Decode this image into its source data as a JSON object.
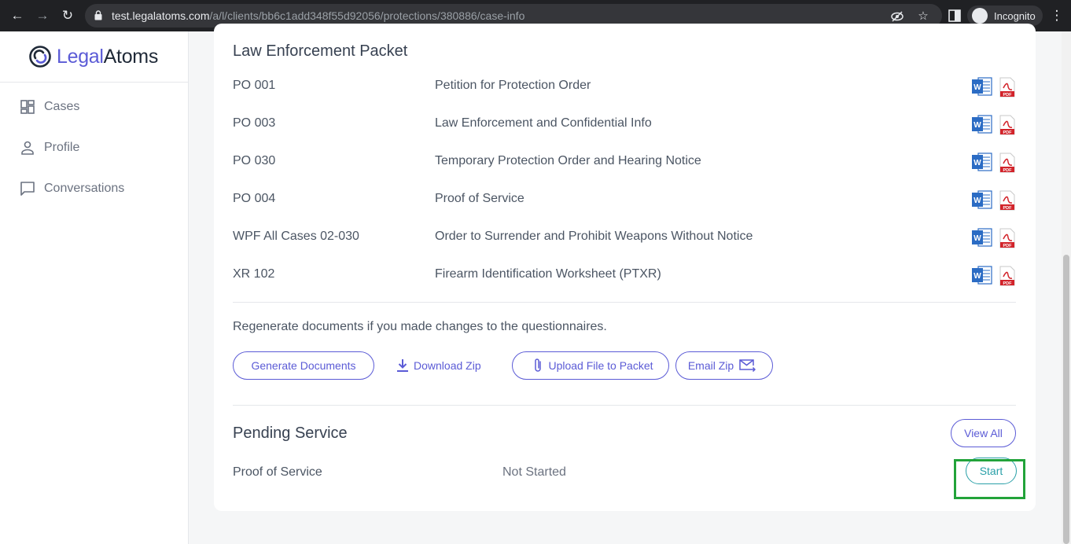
{
  "browser": {
    "url_host": "test.legalatoms.com",
    "url_path": "/a/l/clients/bb6c1add348f55d92056/protections/380886/case-info",
    "incognito_label": "Incognito"
  },
  "sidebar": {
    "logo_legal": "Legal",
    "logo_atoms": "Atoms",
    "items": [
      {
        "label": "Cases",
        "icon": "grid-icon"
      },
      {
        "label": "Profile",
        "icon": "person-icon"
      },
      {
        "label": "Conversations",
        "icon": "chat-icon"
      }
    ]
  },
  "packet": {
    "title": "Law Enforcement Packet",
    "documents": [
      {
        "code": "PO 001",
        "name": "Petition for Protection Order"
      },
      {
        "code": "PO 003",
        "name": "Law Enforcement and Confidential Info"
      },
      {
        "code": "PO 030",
        "name": "Temporary Protection Order and Hearing Notice"
      },
      {
        "code": "PO 004",
        "name": "Proof of Service"
      },
      {
        "code": "WPF All Cases 02-030",
        "name": "Order to Surrender and Prohibit Weapons Without Notice"
      },
      {
        "code": "XR 102",
        "name": "Firearm Identification Worksheet (PTXR)"
      }
    ],
    "regen_text": "Regenerate documents if you made changes to the questionnaires.",
    "buttons": {
      "generate": "Generate Documents",
      "download_zip": "Download Zip",
      "upload": "Upload File to Packet",
      "email_zip": "Email Zip"
    }
  },
  "pending": {
    "title": "Pending Service",
    "view_all": "View All",
    "items": [
      {
        "name": "Proof of Service",
        "status": "Not Started",
        "action": "Start"
      }
    ]
  },
  "colors": {
    "accent": "#5b5bd6",
    "start_teal": "#2aa0a8",
    "highlight_green": "#22a33a"
  }
}
